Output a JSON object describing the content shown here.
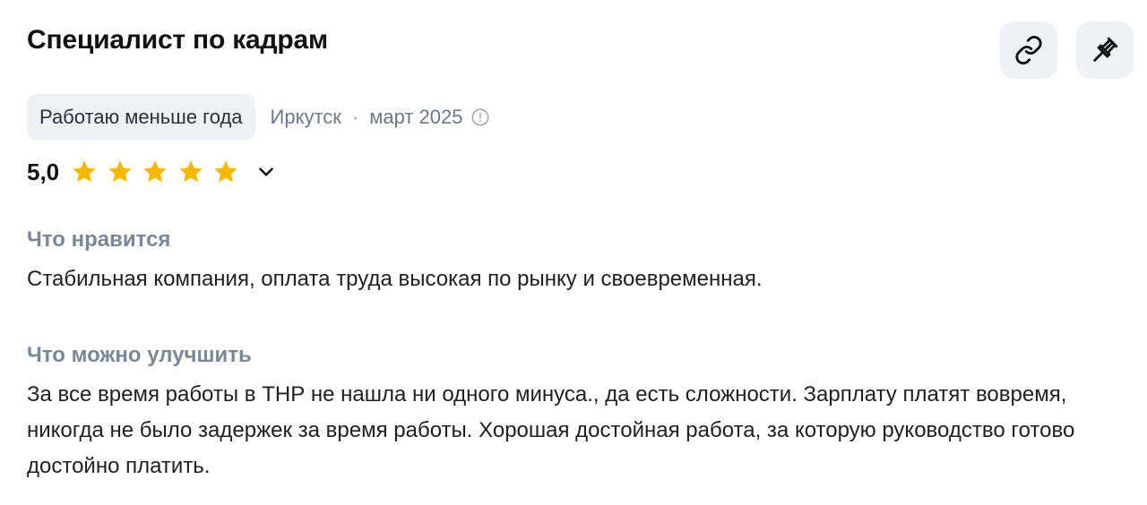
{
  "review": {
    "title": "Специалист по кадрам",
    "tenure": "Работаю меньше года",
    "city": "Иркутск",
    "separator": "·",
    "date": "март 2025",
    "rating": "5,0",
    "stars_filled": 5,
    "stars_total": 5
  },
  "actions": {
    "link_icon": "link-icon",
    "pin_icon": "pin-icon"
  },
  "sections": {
    "pros_label": "Что нравится",
    "pros_text": "Стабильная компания, оплата труда высокая по рынку и своевременная.",
    "cons_label": "Что можно улучшить",
    "cons_text": "За все время работы в ТНР не нашла ни одного минуса., да есть сложности. Зарплату платят вовремя, никогда не было задержек за время работы. Хорошая достойная работа, за которую руководство готово достойно платить."
  },
  "colors": {
    "star": "#f5b800",
    "badge_bg": "#eef1f6",
    "muted_text": "#6b7887"
  }
}
